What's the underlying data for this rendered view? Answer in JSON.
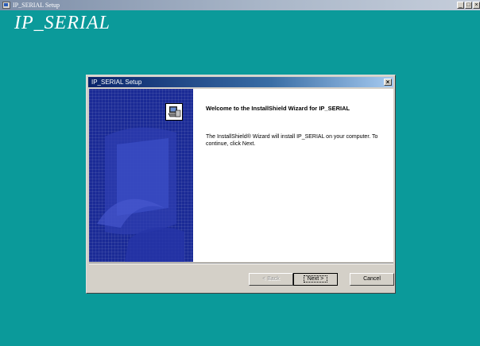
{
  "window": {
    "title": "IP_SERIAL Setup",
    "controls": [
      "_",
      "□",
      "×"
    ]
  },
  "banner": {
    "text": "IP_SERIAL"
  },
  "dialog": {
    "title": "IP_SERIAL Setup",
    "close_glyph": "×",
    "welcome_title": "Welcome to the InstallShield Wizard for IP_SERIAL",
    "welcome_body": "The InstallShield® Wizard will install IP_SERIAL on your computer.  To continue, click Next.",
    "buttons": {
      "back": "< Back",
      "next": "Next >",
      "cancel": "Cancel"
    }
  },
  "colors": {
    "desktop": "#0b9a9a",
    "dialog_face": "#d4d0c8",
    "side_panel": "#1a2a96",
    "title_active": "#0a246a"
  },
  "icons": {
    "app": "installer-app-icon",
    "wizard": "computer-install-icon"
  }
}
